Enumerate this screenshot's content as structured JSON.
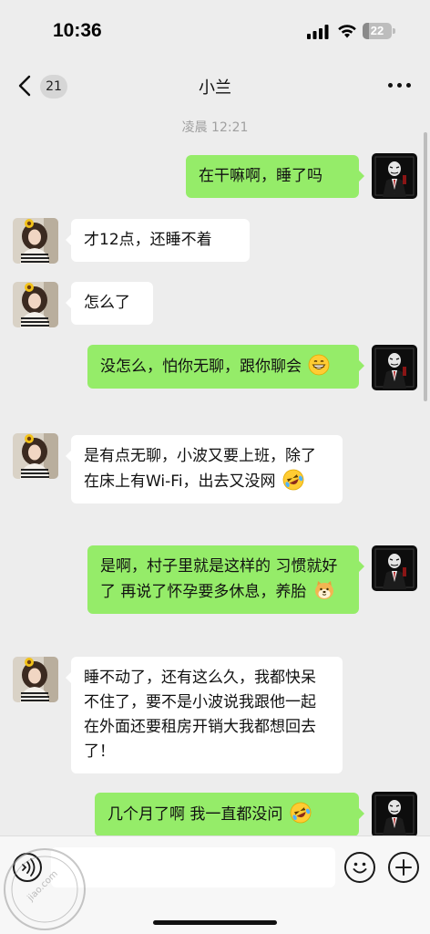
{
  "status_bar": {
    "time": "10:36",
    "battery_level": "22",
    "battery_fraction": 0.22,
    "icons": [
      "signal-icon",
      "wifi-icon",
      "battery-icon"
    ]
  },
  "nav": {
    "back_icon": "chevron-left-icon",
    "unread_count": "21",
    "title": "小兰",
    "more_icon": "more-dots-icon"
  },
  "chat": {
    "timestamp": "凌晨 12:21",
    "messages": [
      {
        "side": "out",
        "text": "在干嘛啊，睡了吗"
      },
      {
        "side": "in",
        "text": "才12点，还睡不着"
      },
      {
        "side": "in",
        "text": "怎么了"
      },
      {
        "side": "out",
        "text": "没怎么，怕你无聊，跟你聊会",
        "emoji": "grinning-face-icon"
      },
      {
        "side": "in",
        "text": "是有点无聊，小波又要上班，除了在床上有Wi-Fi，出去又没网",
        "emoji": "rolling-laughing-icon"
      },
      {
        "side": "out",
        "text": "是啊，村子里就是这样的 习惯就好了 再说了怀孕要多休息，养胎",
        "emoji": "dog-face-icon"
      },
      {
        "side": "in",
        "text": "睡不动了，还有这么久，我都快呆不住了，要不是小波说我跟他一起在外面还要租房开销大我都想回去了！"
      },
      {
        "side": "out",
        "text": "几个月了啊 我一直都没问",
        "emoji": "rolling-laughing-icon"
      }
    ]
  },
  "input_bar": {
    "voice_icon": "voice-icon",
    "emoji_icon": "emoji-icon",
    "plus_icon": "plus-icon",
    "input_value": ""
  },
  "watermark": {
    "text": "jiao.com"
  },
  "colors": {
    "background": "#ededed",
    "outgoing_bubble": "#95ec69",
    "incoming_bubble": "#ffffff"
  }
}
